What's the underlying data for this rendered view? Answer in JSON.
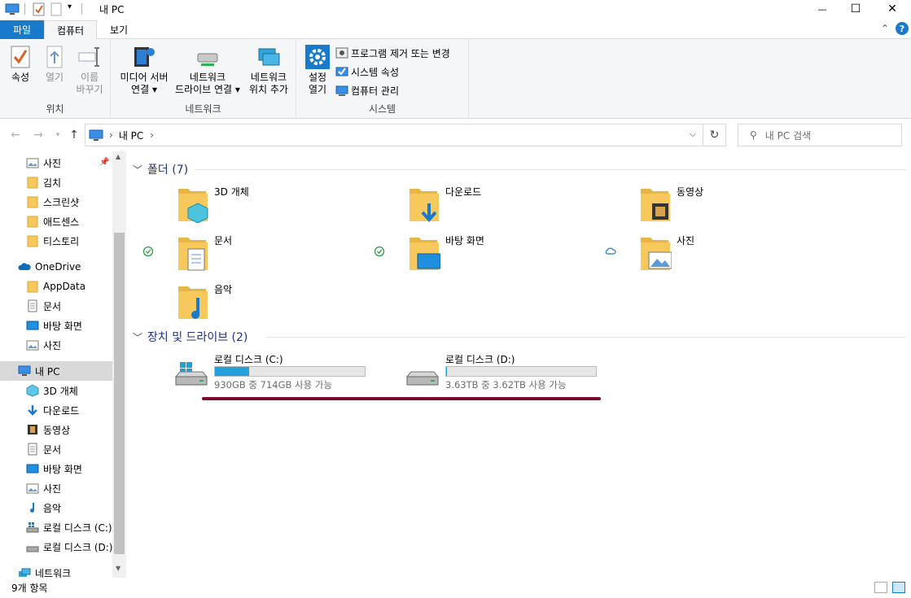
{
  "window": {
    "title": "내 PC",
    "minimize_glyph": "—",
    "maximize_glyph": "☐",
    "close_glyph": "✕"
  },
  "tabs": {
    "file": "파일",
    "computer": "컴퓨터",
    "view": "보기"
  },
  "ribbon": {
    "location_group": {
      "label": "위치",
      "properties": "속성",
      "open": "열기",
      "rename_l1": "이름",
      "rename_l2": "바꾸기"
    },
    "network_group": {
      "label": "네트워크",
      "media_l1": "미디어 서버",
      "media_l2": "연결",
      "map_l1": "네트워크",
      "map_l2": "드라이브 연결",
      "addloc_l1": "네트워크",
      "addloc_l2": "위치 추가"
    },
    "system_group": {
      "label": "시스템",
      "settings_l1": "설정",
      "settings_l2": "열기",
      "uninstall": "프로그램 제거 또는 변경",
      "sysprops": "시스템 속성",
      "manage": "컴퓨터 관리"
    }
  },
  "address": {
    "path": "내 PC",
    "search_placeholder": "내 PC 검색"
  },
  "sidebar": {
    "quick": [
      "사진",
      "김치",
      "스크린샷",
      "애드센스",
      "티스토리"
    ],
    "onedrive": "OneDrive",
    "onedrive_items": [
      "AppData",
      "문서",
      "바탕 화면",
      "사진"
    ],
    "thispc": "내 PC",
    "thispc_items": [
      "3D 개체",
      "다운로드",
      "동영상",
      "문서",
      "바탕 화면",
      "사진",
      "음악",
      "로컬 디스크 (C:)",
      "로컬 디스크 (D:)"
    ],
    "network": "네트워크"
  },
  "main": {
    "folders_header": "폴더 (7)",
    "folders": [
      "3D 개체",
      "다운로드",
      "동영상",
      "문서",
      "바탕 화면",
      "사진",
      "음악"
    ],
    "drives_header": "장치 및 드라이브 (2)",
    "drives": [
      {
        "name": "로컬 디스크 (C:)",
        "info": "930GB 중 714GB 사용 가능",
        "used_fraction": 0.23
      },
      {
        "name": "로컬 디스크 (D:)",
        "info": "3.63TB 중 3.62TB 사용 가능",
        "used_fraction": 0.003
      }
    ]
  },
  "status": {
    "count": "9개 항목"
  },
  "colors": {
    "accent": "#1979ca",
    "folder": "#f7c95c",
    "drive_fill": "#26a0da",
    "underline": "#7b0c2c"
  }
}
